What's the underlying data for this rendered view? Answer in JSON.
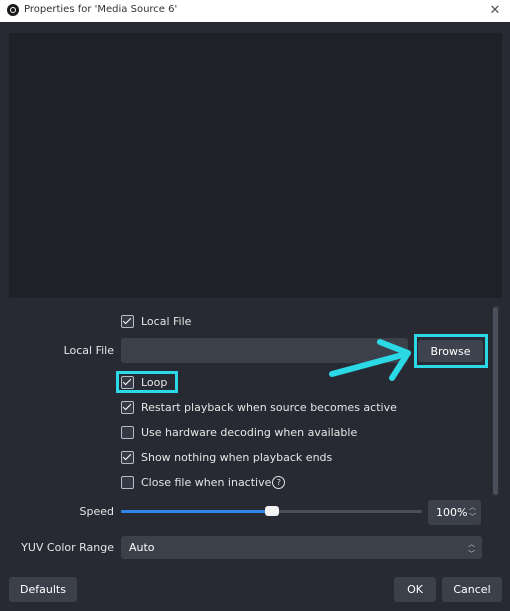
{
  "window": {
    "title": "Properties for 'Media Source 6'",
    "close_icon": "close-icon",
    "app_icon": "obs-logo-icon"
  },
  "properties": {
    "local_file_checkbox": {
      "label": "Local File",
      "checked": true
    },
    "local_file_field": {
      "label": "Local File",
      "value": "",
      "browse_label": "Browse"
    },
    "loop": {
      "label": "Loop",
      "checked": true
    },
    "restart": {
      "label": "Restart playback when source becomes active",
      "checked": true
    },
    "hw_decoding": {
      "label": "Use hardware decoding when available",
      "checked": false
    },
    "show_nothing": {
      "label": "Show nothing when playback ends",
      "checked": true
    },
    "close_inactive": {
      "label": "Close file when inactive",
      "checked": false,
      "help_icon": "help-icon"
    },
    "speed": {
      "label": "Speed",
      "value": "100%",
      "slider_fraction": 0.5
    },
    "yuv": {
      "label": "YUV Color Range",
      "value": "Auto"
    }
  },
  "buttons": {
    "defaults": "Defaults",
    "ok": "OK",
    "cancel": "Cancel"
  },
  "annotations": {
    "highlight_color": "#2ad8e6",
    "arrow": "arrow-right-icon"
  },
  "colors": {
    "background": "#272a33",
    "field": "#3c404b",
    "slider_fill": "#2f86e8"
  }
}
